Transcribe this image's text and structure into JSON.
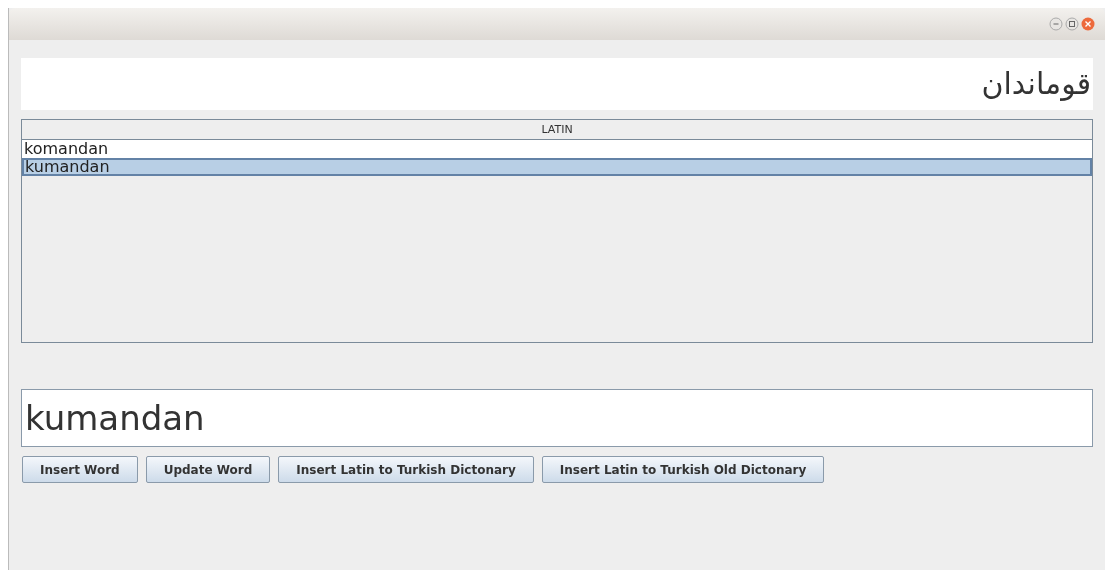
{
  "arabic_field": {
    "value": "قوماندان"
  },
  "table": {
    "columns": [
      "LATIN"
    ],
    "rows": [
      {
        "cells": [
          "komandan"
        ],
        "selected": false
      },
      {
        "cells": [
          "kumandan"
        ],
        "selected": true
      }
    ]
  },
  "word_field": {
    "value": "kumandan"
  },
  "buttons": [
    "Insert Word",
    "Update Word",
    "Insert Latin to Turkish Dictonary",
    "Insert Latin to Turkish Old Dictonary"
  ]
}
